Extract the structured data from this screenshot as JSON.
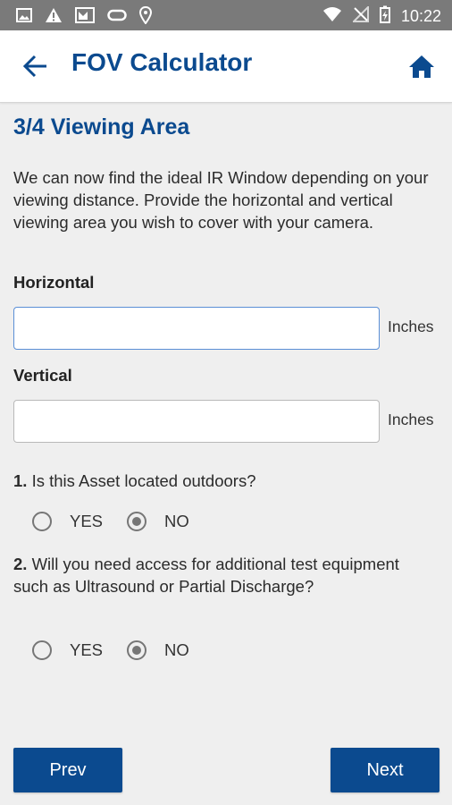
{
  "status_bar": {
    "time": "10:22",
    "left_icons": [
      "image-icon",
      "warning-icon",
      "gallery-icon",
      "voicemail-icon",
      "location-icon"
    ],
    "right_icons": [
      "wifi-icon",
      "no-signal-icon",
      "battery-charging-icon"
    ]
  },
  "app_bar": {
    "title": "FOV Calculator",
    "back_icon": "arrow-back-icon",
    "home_icon": "home-icon",
    "accent_color": "#0b4a8f"
  },
  "section": {
    "title": "3/4 Viewing Area",
    "intro": "We can now find the ideal IR Window depending on your viewing distance. Provide the horizontal and vertical viewing area you wish to cover with your camera."
  },
  "fields": {
    "horizontal": {
      "label": "Horizontal",
      "value": "",
      "unit": "Inches"
    },
    "vertical": {
      "label": "Vertical",
      "value": "",
      "unit": "Inches"
    }
  },
  "questions": [
    {
      "number": "1.",
      "text": "Is this Asset located outdoors?",
      "options": [
        "YES",
        "NO"
      ],
      "selected": "NO"
    },
    {
      "number": "2.",
      "text": "Will you need access for additional test equipment such as Ultrasound or Partial Discharge?",
      "options": [
        "YES",
        "NO"
      ],
      "selected": "NO"
    }
  ],
  "buttons": {
    "prev": "Prev",
    "next": "Next"
  }
}
